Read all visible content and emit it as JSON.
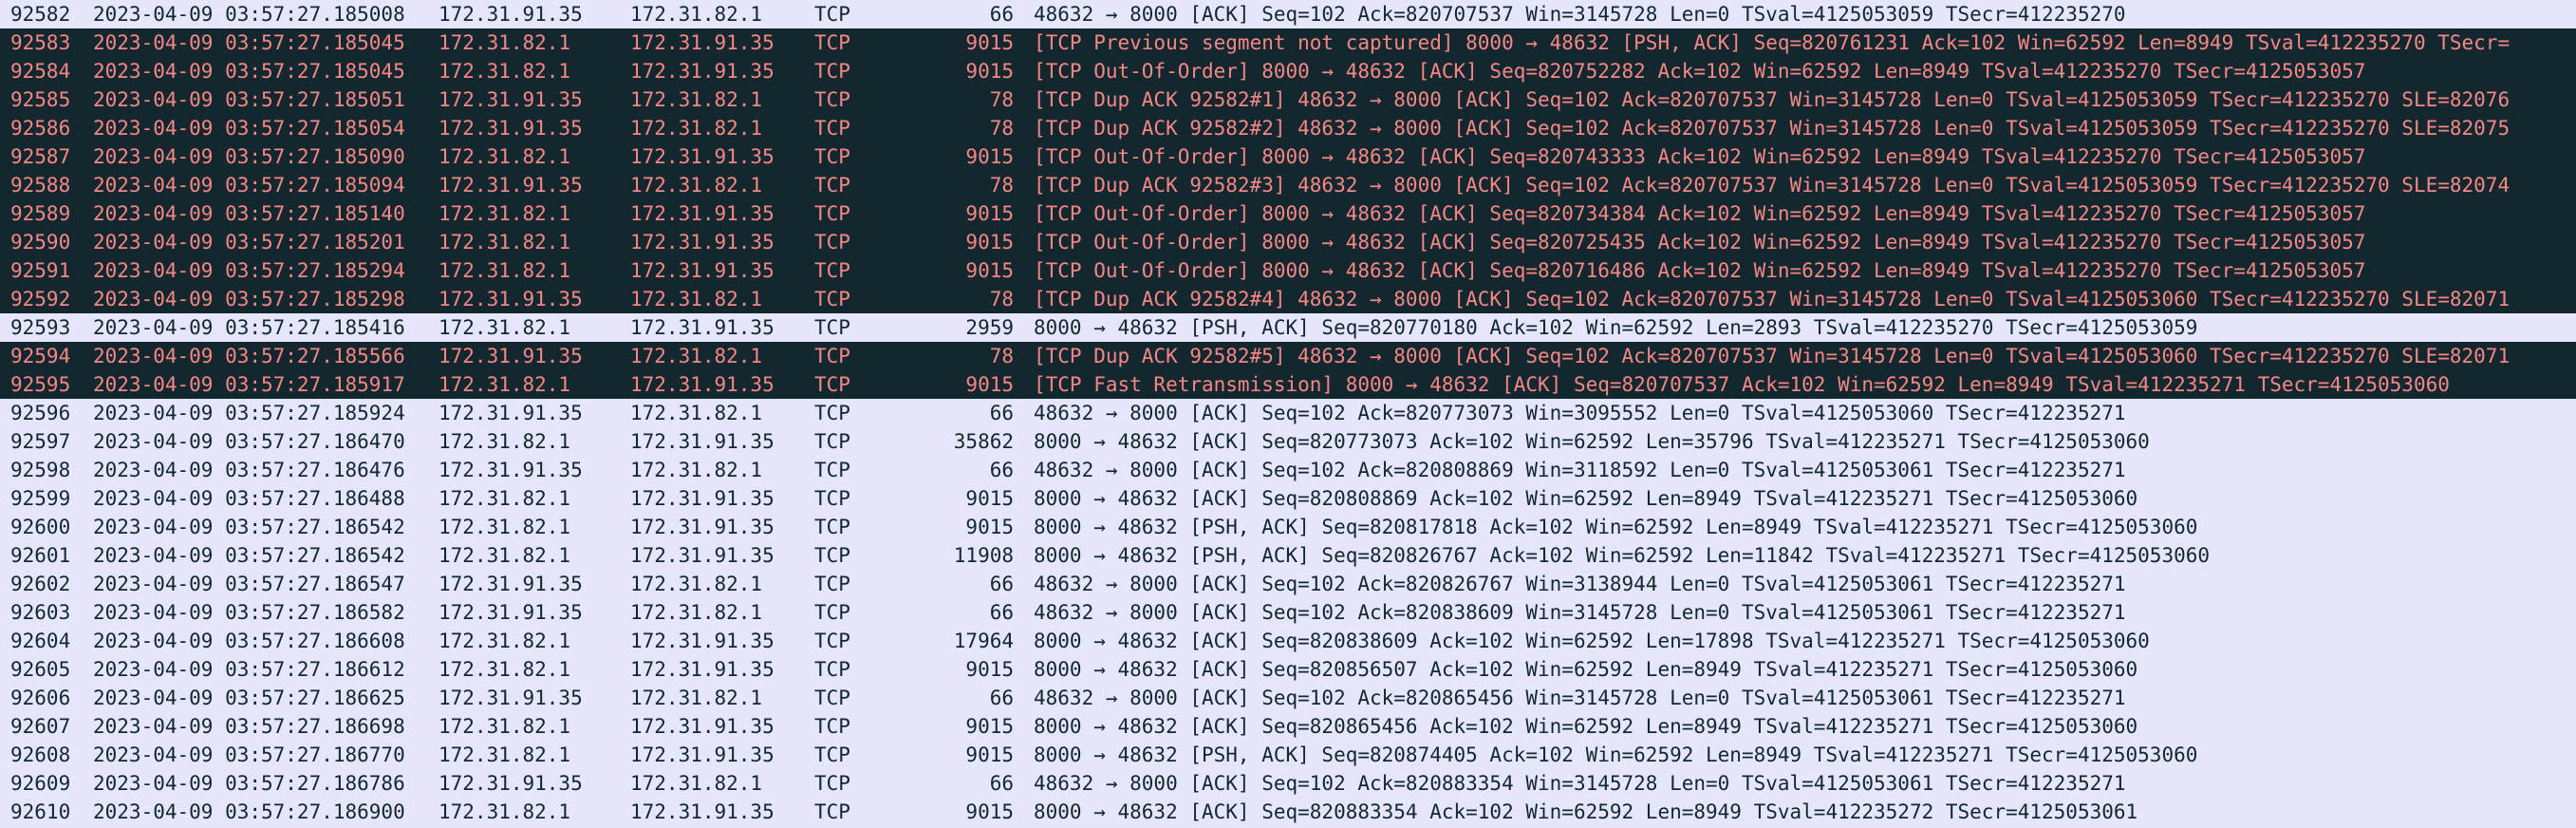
{
  "packets": [
    {
      "no": "92582",
      "time": "2023-04-09 03:57:27.185008",
      "src": "172.31.91.35",
      "dst": "172.31.82.1",
      "proto": "TCP",
      "len": "66",
      "info": "48632 → 8000 [ACK] Seq=102 Ack=820707537 Win=3145728 Len=0 TSval=4125053059 TSecr=412235270",
      "style": "normal"
    },
    {
      "no": "92583",
      "time": "2023-04-09 03:57:27.185045",
      "src": "172.31.82.1",
      "dst": "172.31.91.35",
      "proto": "TCP",
      "len": "9015",
      "info": "[TCP Previous segment not captured] 8000 → 48632 [PSH, ACK] Seq=820761231 Ack=102 Win=62592 Len=8949 TSval=412235270 TSecr=",
      "style": "bad"
    },
    {
      "no": "92584",
      "time": "2023-04-09 03:57:27.185045",
      "src": "172.31.82.1",
      "dst": "172.31.91.35",
      "proto": "TCP",
      "len": "9015",
      "info": "[TCP Out-Of-Order] 8000 → 48632 [ACK] Seq=820752282 Ack=102 Win=62592 Len=8949 TSval=412235270 TSecr=4125053057",
      "style": "bad"
    },
    {
      "no": "92585",
      "time": "2023-04-09 03:57:27.185051",
      "src": "172.31.91.35",
      "dst": "172.31.82.1",
      "proto": "TCP",
      "len": "78",
      "info": "[TCP Dup ACK 92582#1] 48632 → 8000 [ACK] Seq=102 Ack=820707537 Win=3145728 Len=0 TSval=4125053059 TSecr=412235270 SLE=82076",
      "style": "bad"
    },
    {
      "no": "92586",
      "time": "2023-04-09 03:57:27.185054",
      "src": "172.31.91.35",
      "dst": "172.31.82.1",
      "proto": "TCP",
      "len": "78",
      "info": "[TCP Dup ACK 92582#2] 48632 → 8000 [ACK] Seq=102 Ack=820707537 Win=3145728 Len=0 TSval=4125053059 TSecr=412235270 SLE=82075",
      "style": "bad"
    },
    {
      "no": "92587",
      "time": "2023-04-09 03:57:27.185090",
      "src": "172.31.82.1",
      "dst": "172.31.91.35",
      "proto": "TCP",
      "len": "9015",
      "info": "[TCP Out-Of-Order] 8000 → 48632 [ACK] Seq=820743333 Ack=102 Win=62592 Len=8949 TSval=412235270 TSecr=4125053057",
      "style": "bad"
    },
    {
      "no": "92588",
      "time": "2023-04-09 03:57:27.185094",
      "src": "172.31.91.35",
      "dst": "172.31.82.1",
      "proto": "TCP",
      "len": "78",
      "info": "[TCP Dup ACK 92582#3] 48632 → 8000 [ACK] Seq=102 Ack=820707537 Win=3145728 Len=0 TSval=4125053059 TSecr=412235270 SLE=82074",
      "style": "bad"
    },
    {
      "no": "92589",
      "time": "2023-04-09 03:57:27.185140",
      "src": "172.31.82.1",
      "dst": "172.31.91.35",
      "proto": "TCP",
      "len": "9015",
      "info": "[TCP Out-Of-Order] 8000 → 48632 [ACK] Seq=820734384 Ack=102 Win=62592 Len=8949 TSval=412235270 TSecr=4125053057",
      "style": "bad"
    },
    {
      "no": "92590",
      "time": "2023-04-09 03:57:27.185201",
      "src": "172.31.82.1",
      "dst": "172.31.91.35",
      "proto": "TCP",
      "len": "9015",
      "info": "[TCP Out-Of-Order] 8000 → 48632 [ACK] Seq=820725435 Ack=102 Win=62592 Len=8949 TSval=412235270 TSecr=4125053057",
      "style": "bad"
    },
    {
      "no": "92591",
      "time": "2023-04-09 03:57:27.185294",
      "src": "172.31.82.1",
      "dst": "172.31.91.35",
      "proto": "TCP",
      "len": "9015",
      "info": "[TCP Out-Of-Order] 8000 → 48632 [ACK] Seq=820716486 Ack=102 Win=62592 Len=8949 TSval=412235270 TSecr=4125053057",
      "style": "bad"
    },
    {
      "no": "92592",
      "time": "2023-04-09 03:57:27.185298",
      "src": "172.31.91.35",
      "dst": "172.31.82.1",
      "proto": "TCP",
      "len": "78",
      "info": "[TCP Dup ACK 92582#4] 48632 → 8000 [ACK] Seq=102 Ack=820707537 Win=3145728 Len=0 TSval=4125053060 TSecr=412235270 SLE=82071",
      "style": "bad"
    },
    {
      "no": "92593",
      "time": "2023-04-09 03:57:27.185416",
      "src": "172.31.82.1",
      "dst": "172.31.91.35",
      "proto": "TCP",
      "len": "2959",
      "info": "8000 → 48632 [PSH, ACK] Seq=820770180 Ack=102 Win=62592 Len=2893 TSval=412235270 TSecr=4125053059",
      "style": "normal"
    },
    {
      "no": "92594",
      "time": "2023-04-09 03:57:27.185566",
      "src": "172.31.91.35",
      "dst": "172.31.82.1",
      "proto": "TCP",
      "len": "78",
      "info": "[TCP Dup ACK 92582#5] 48632 → 8000 [ACK] Seq=102 Ack=820707537 Win=3145728 Len=0 TSval=4125053060 TSecr=412235270 SLE=82071",
      "style": "bad"
    },
    {
      "no": "92595",
      "time": "2023-04-09 03:57:27.185917",
      "src": "172.31.82.1",
      "dst": "172.31.91.35",
      "proto": "TCP",
      "len": "9015",
      "info": "[TCP Fast Retransmission] 8000 → 48632 [ACK] Seq=820707537 Ack=102 Win=62592 Len=8949 TSval=412235271 TSecr=4125053060",
      "style": "bad"
    },
    {
      "no": "92596",
      "time": "2023-04-09 03:57:27.185924",
      "src": "172.31.91.35",
      "dst": "172.31.82.1",
      "proto": "TCP",
      "len": "66",
      "info": "48632 → 8000 [ACK] Seq=102 Ack=820773073 Win=3095552 Len=0 TSval=4125053060 TSecr=412235271",
      "style": "normal"
    },
    {
      "no": "92597",
      "time": "2023-04-09 03:57:27.186470",
      "src": "172.31.82.1",
      "dst": "172.31.91.35",
      "proto": "TCP",
      "len": "35862",
      "info": "8000 → 48632 [ACK] Seq=820773073 Ack=102 Win=62592 Len=35796 TSval=412235271 TSecr=4125053060",
      "style": "normal"
    },
    {
      "no": "92598",
      "time": "2023-04-09 03:57:27.186476",
      "src": "172.31.91.35",
      "dst": "172.31.82.1",
      "proto": "TCP",
      "len": "66",
      "info": "48632 → 8000 [ACK] Seq=102 Ack=820808869 Win=3118592 Len=0 TSval=4125053061 TSecr=412235271",
      "style": "normal"
    },
    {
      "no": "92599",
      "time": "2023-04-09 03:57:27.186488",
      "src": "172.31.82.1",
      "dst": "172.31.91.35",
      "proto": "TCP",
      "len": "9015",
      "info": "8000 → 48632 [ACK] Seq=820808869 Ack=102 Win=62592 Len=8949 TSval=412235271 TSecr=4125053060",
      "style": "normal"
    },
    {
      "no": "92600",
      "time": "2023-04-09 03:57:27.186542",
      "src": "172.31.82.1",
      "dst": "172.31.91.35",
      "proto": "TCP",
      "len": "9015",
      "info": "8000 → 48632 [PSH, ACK] Seq=820817818 Ack=102 Win=62592 Len=8949 TSval=412235271 TSecr=4125053060",
      "style": "normal"
    },
    {
      "no": "92601",
      "time": "2023-04-09 03:57:27.186542",
      "src": "172.31.82.1",
      "dst": "172.31.91.35",
      "proto": "TCP",
      "len": "11908",
      "info": "8000 → 48632 [PSH, ACK] Seq=820826767 Ack=102 Win=62592 Len=11842 TSval=412235271 TSecr=4125053060",
      "style": "normal"
    },
    {
      "no": "92602",
      "time": "2023-04-09 03:57:27.186547",
      "src": "172.31.91.35",
      "dst": "172.31.82.1",
      "proto": "TCP",
      "len": "66",
      "info": "48632 → 8000 [ACK] Seq=102 Ack=820826767 Win=3138944 Len=0 TSval=4125053061 TSecr=412235271",
      "style": "normal"
    },
    {
      "no": "92603",
      "time": "2023-04-09 03:57:27.186582",
      "src": "172.31.91.35",
      "dst": "172.31.82.1",
      "proto": "TCP",
      "len": "66",
      "info": "48632 → 8000 [ACK] Seq=102 Ack=820838609 Win=3145728 Len=0 TSval=4125053061 TSecr=412235271",
      "style": "normal"
    },
    {
      "no": "92604",
      "time": "2023-04-09 03:57:27.186608",
      "src": "172.31.82.1",
      "dst": "172.31.91.35",
      "proto": "TCP",
      "len": "17964",
      "info": "8000 → 48632 [ACK] Seq=820838609 Ack=102 Win=62592 Len=17898 TSval=412235271 TSecr=4125053060",
      "style": "normal"
    },
    {
      "no": "92605",
      "time": "2023-04-09 03:57:27.186612",
      "src": "172.31.82.1",
      "dst": "172.31.91.35",
      "proto": "TCP",
      "len": "9015",
      "info": "8000 → 48632 [ACK] Seq=820856507 Ack=102 Win=62592 Len=8949 TSval=412235271 TSecr=4125053060",
      "style": "normal"
    },
    {
      "no": "92606",
      "time": "2023-04-09 03:57:27.186625",
      "src": "172.31.91.35",
      "dst": "172.31.82.1",
      "proto": "TCP",
      "len": "66",
      "info": "48632 → 8000 [ACK] Seq=102 Ack=820865456 Win=3145728 Len=0 TSval=4125053061 TSecr=412235271",
      "style": "normal"
    },
    {
      "no": "92607",
      "time": "2023-04-09 03:57:27.186698",
      "src": "172.31.82.1",
      "dst": "172.31.91.35",
      "proto": "TCP",
      "len": "9015",
      "info": "8000 → 48632 [ACK] Seq=820865456 Ack=102 Win=62592 Len=8949 TSval=412235271 TSecr=4125053060",
      "style": "normal"
    },
    {
      "no": "92608",
      "time": "2023-04-09 03:57:27.186770",
      "src": "172.31.82.1",
      "dst": "172.31.91.35",
      "proto": "TCP",
      "len": "9015",
      "info": "8000 → 48632 [PSH, ACK] Seq=820874405 Ack=102 Win=62592 Len=8949 TSval=412235271 TSecr=4125053060",
      "style": "normal"
    },
    {
      "no": "92609",
      "time": "2023-04-09 03:57:27.186786",
      "src": "172.31.91.35",
      "dst": "172.31.82.1",
      "proto": "TCP",
      "len": "66",
      "info": "48632 → 8000 [ACK] Seq=102 Ack=820883354 Win=3145728 Len=0 TSval=4125053061 TSecr=412235271",
      "style": "normal"
    },
    {
      "no": "92610",
      "time": "2023-04-09 03:57:27.186900",
      "src": "172.31.82.1",
      "dst": "172.31.91.35",
      "proto": "TCP",
      "len": "9015",
      "info": "8000 → 48632 [ACK] Seq=820883354 Ack=102 Win=62592 Len=8949 TSval=412235272 TSecr=4125053061",
      "style": "normal"
    }
  ],
  "colors": {
    "normal_bg": "#e6e6fa",
    "normal_fg": "#12272e",
    "bad_bg": "#12272e",
    "bad_fg": "#f78787"
  }
}
